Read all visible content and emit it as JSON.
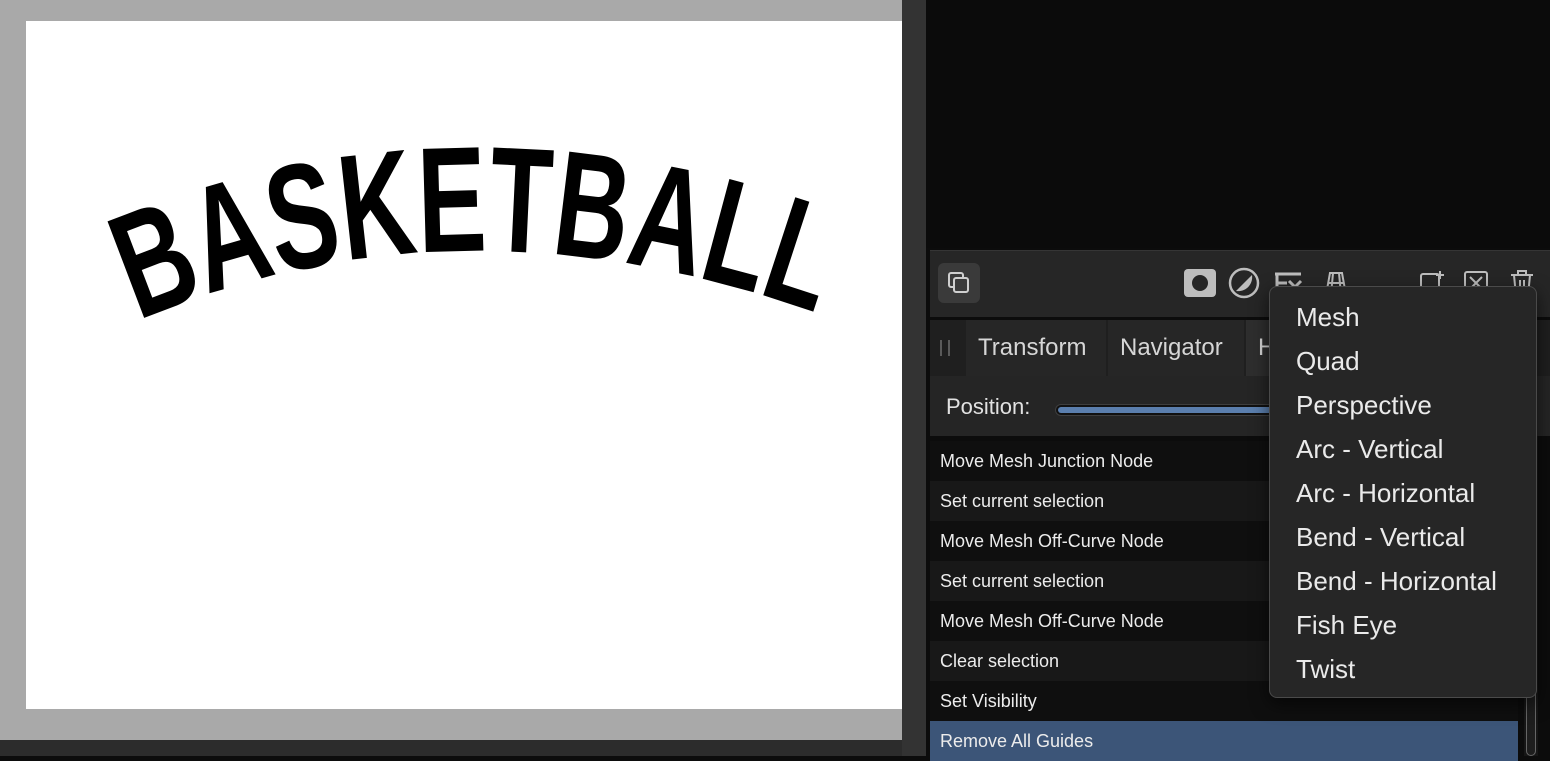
{
  "document": {
    "artwork_text": "BASKETBALL"
  },
  "layers_toolbar": {
    "icons": [
      "layers-icon",
      "fill-mask-icon",
      "adjustment-icon",
      "fx-icon",
      "live-filter-icon",
      "add-layer-icon",
      "add-pixel-layer-icon",
      "trash-icon"
    ]
  },
  "tabs": [
    {
      "label": "Transform"
    },
    {
      "label": "Navigator"
    },
    {
      "label": "H"
    }
  ],
  "history": {
    "position_label": "Position:",
    "position_fraction": 1.0,
    "items": [
      {
        "label": "Move Mesh Junction Node"
      },
      {
        "label": "Set current selection"
      },
      {
        "label": "Move Mesh Off-Curve Node"
      },
      {
        "label": "Set current selection"
      },
      {
        "label": "Move Mesh Off-Curve Node"
      },
      {
        "label": "Clear selection"
      },
      {
        "label": "Set Visibility"
      },
      {
        "label": "Remove All Guides"
      }
    ],
    "selected_index": 7
  },
  "warp_menu": {
    "items": [
      {
        "label": "Mesh"
      },
      {
        "label": "Quad"
      },
      {
        "label": "Perspective"
      },
      {
        "label": "Arc - Vertical"
      },
      {
        "label": "Arc - Horizontal"
      },
      {
        "label": "Bend - Vertical"
      },
      {
        "label": "Bend - Horizontal"
      },
      {
        "label": "Fish Eye"
      },
      {
        "label": "Twist"
      }
    ]
  },
  "colors": {
    "selection": "#3c5578",
    "slider_fill": "#5b7fae"
  }
}
